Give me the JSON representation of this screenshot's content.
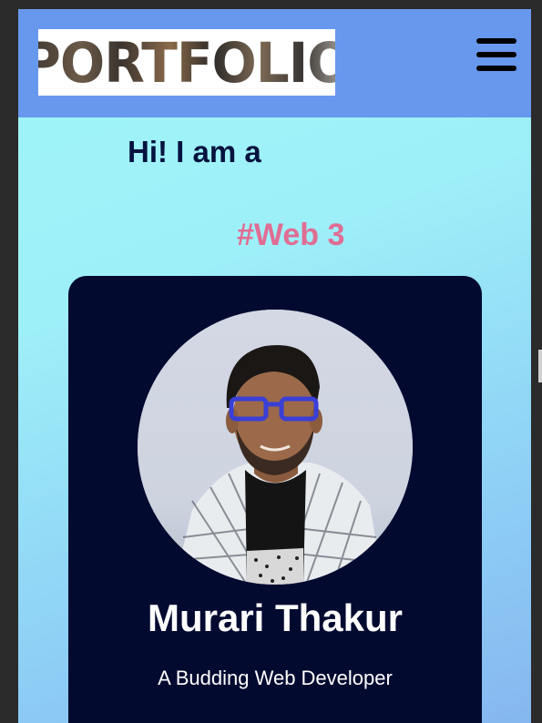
{
  "navbar": {
    "logo_text": "PORTFOLIO",
    "menu_icon": "hamburger-menu-icon"
  },
  "hero": {
    "greeting": "Hi! I am a",
    "role": "#Web 3"
  },
  "profile_card": {
    "name": "Murari Thakur",
    "tagline": "A Budding Web Developer",
    "avatar": "profile-photo"
  },
  "colors": {
    "navbar_bg": "#6898ee",
    "card_bg": "#020a30",
    "greeting": "#06133f",
    "role_accent": "#e06d93"
  }
}
